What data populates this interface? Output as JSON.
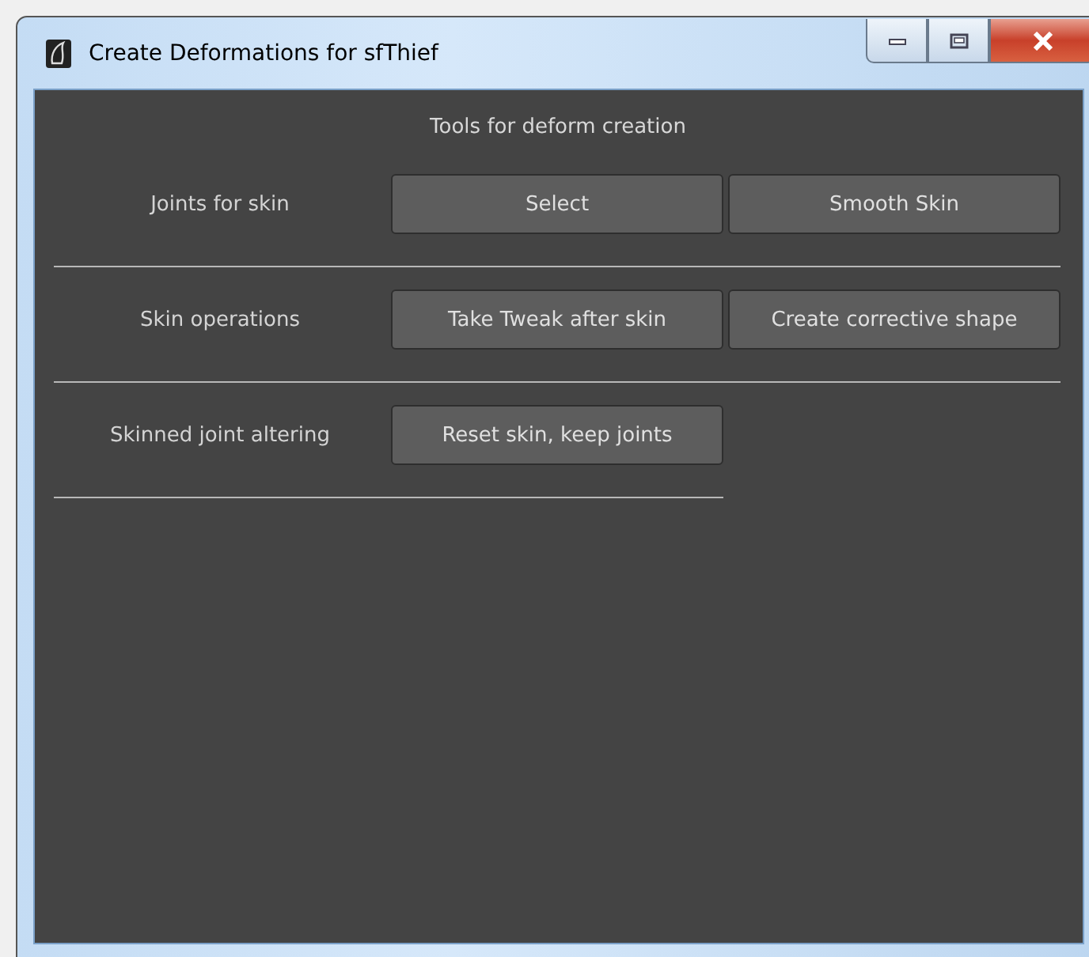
{
  "window": {
    "title": "Create Deformations for sfThief"
  },
  "heading": "Tools for deform creation",
  "sections": [
    {
      "label": "Joints for skin",
      "buttons": [
        "Select",
        "Smooth Skin"
      ]
    },
    {
      "label": "Skin operations",
      "buttons": [
        "Take Tweak after skin",
        "Create corrective shape"
      ]
    },
    {
      "label": "Skinned joint altering",
      "buttons": [
        "Reset skin, keep joints"
      ]
    }
  ]
}
